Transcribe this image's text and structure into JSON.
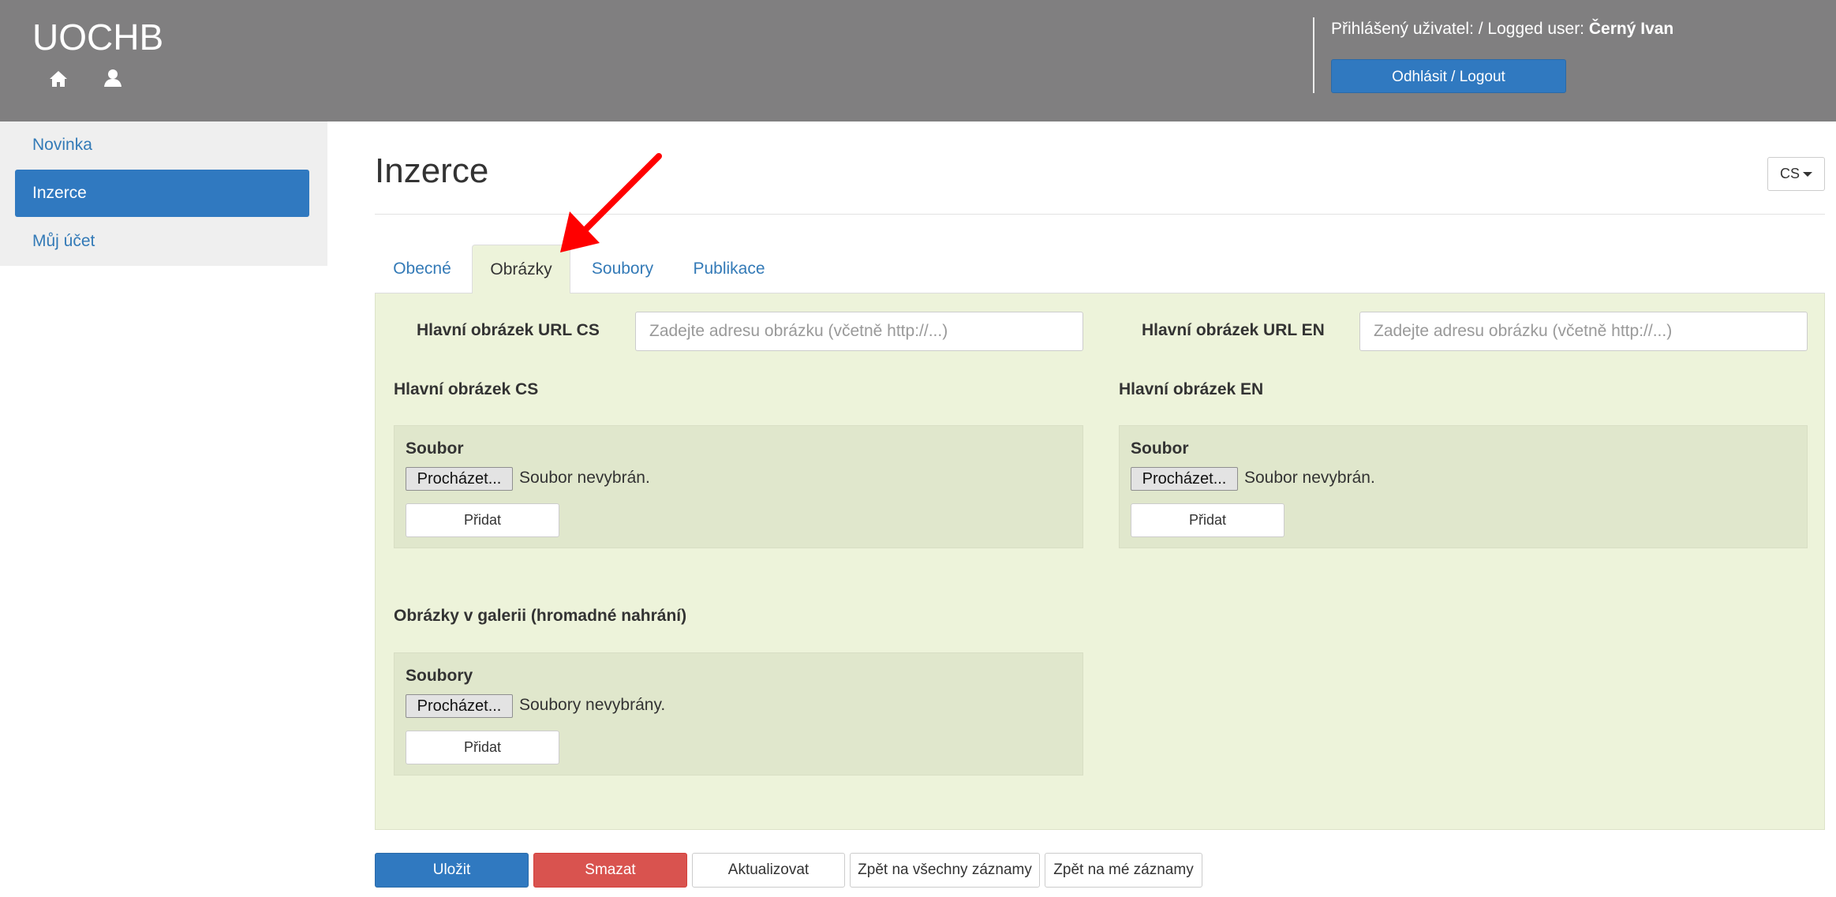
{
  "header": {
    "brand": "UOCHB",
    "logged_user_label": "Přihlášený uživatel: / Logged user:",
    "logged_user_name": "Černý Ivan",
    "logout_label": "Odhlásit / Logout",
    "icons": [
      "home-icon",
      "user-icon"
    ]
  },
  "sidebar": {
    "items": [
      {
        "label": "Novinka",
        "active": false
      },
      {
        "label": "Inzerce",
        "active": true
      },
      {
        "label": "Můj účet",
        "active": false
      }
    ]
  },
  "page": {
    "title": "Inzerce",
    "language": "CS"
  },
  "tabs": [
    {
      "label": "Obecné",
      "active": false
    },
    {
      "label": "Obrázky",
      "active": true
    },
    {
      "label": "Soubory",
      "active": false
    },
    {
      "label": "Publikace",
      "active": false
    }
  ],
  "images_tab": {
    "url_cs_label": "Hlavní obrázek URL CS",
    "url_cs_placeholder": "Zadejte adresu obrázku (včetně http://...)",
    "url_cs_value": "",
    "url_en_label": "Hlavní obrázek URL EN",
    "url_en_placeholder": "Zadejte adresu obrázku (včetně http://...)",
    "url_en_value": "",
    "main_cs": {
      "heading": "Hlavní obrázek CS",
      "box_label": "Soubor",
      "browse_label": "Procházet...",
      "status": "Soubor nevybrán.",
      "add_label": "Přidat"
    },
    "main_en": {
      "heading": "Hlavní obrázek EN",
      "box_label": "Soubor",
      "browse_label": "Procházet...",
      "status": "Soubor nevybrán.",
      "add_label": "Přidat"
    },
    "gallery": {
      "heading": "Obrázky v galerii (hromadné nahrání)",
      "box_label": "Soubory",
      "browse_label": "Procházet...",
      "status": "Soubory nevybrány.",
      "add_label": "Přidat"
    }
  },
  "actions": {
    "save": "Uložit",
    "delete": "Smazat",
    "update": "Aktualizovat",
    "back_all": "Zpět na všechny záznamy",
    "back_mine": "Zpět na mé záznamy"
  },
  "colors": {
    "header_bg": "#807f80",
    "primary": "#3079c0",
    "danger": "#d9534f",
    "panel_bg": "#edf3da",
    "upload_box_bg": "#e0e7cc",
    "annotation_arrow": "#ff0000"
  }
}
